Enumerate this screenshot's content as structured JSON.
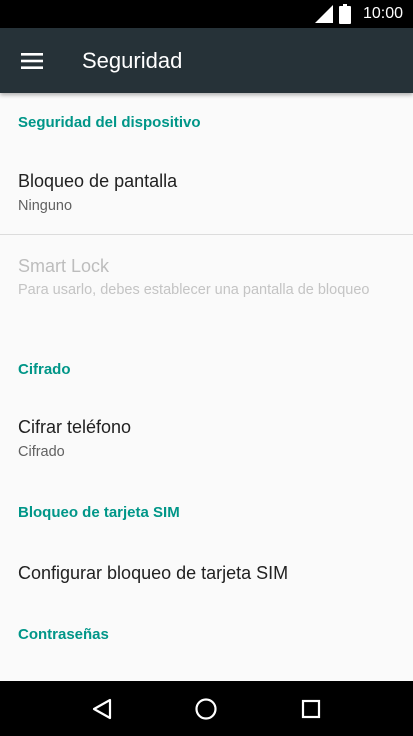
{
  "status_bar": {
    "time": "10:00"
  },
  "app_bar": {
    "title": "Seguridad"
  },
  "sections": {
    "device_security": {
      "header": "Seguridad del dispositivo",
      "screen_lock": {
        "title": "Bloqueo de pantalla",
        "summary": "Ninguno"
      },
      "smart_lock": {
        "title": "Smart Lock",
        "summary": "Para usarlo, debes establecer una pantalla de bloqueo"
      }
    },
    "encryption": {
      "header": "Cifrado",
      "encrypt_phone": {
        "title": "Cifrar teléfono",
        "summary": "Cifrado"
      }
    },
    "sim_lock": {
      "header": "Bloqueo de tarjeta SIM",
      "configure": {
        "title": "Configurar bloqueo de tarjeta SIM"
      }
    },
    "passwords": {
      "header": "Contraseñas"
    }
  },
  "colors": {
    "accent": "#009688",
    "app_bar": "#263238",
    "background": "#fafafa"
  }
}
